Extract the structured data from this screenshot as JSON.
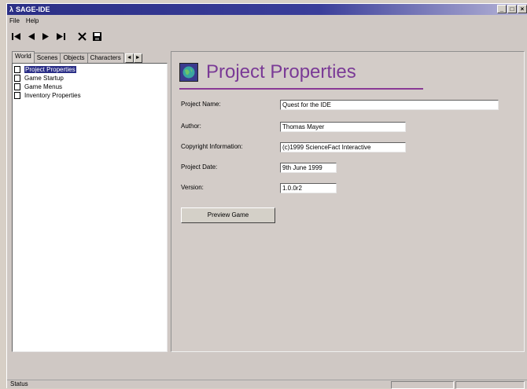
{
  "window": {
    "title": "SAGE-IDE",
    "min": "_",
    "max": "□",
    "close": "×"
  },
  "menu": {
    "file": "File",
    "help": "Help"
  },
  "toolbar": {
    "icons": [
      "first-icon",
      "previous-icon",
      "next-icon",
      "last-icon",
      "delete-icon",
      "save-icon"
    ]
  },
  "tabs": {
    "world": "World",
    "scenes": "Scenes",
    "objects": "Objects",
    "characters": "Characters",
    "left_arrow": "◄",
    "right_arrow": "►"
  },
  "tree": [
    {
      "label": "Project Properties",
      "selected": true
    },
    {
      "label": "Game Startup",
      "selected": false
    },
    {
      "label": "Game Menus",
      "selected": false
    },
    {
      "label": "Inventory Properties",
      "selected": false
    }
  ],
  "page": {
    "title": "Project Properties",
    "accent": "#7a3a96",
    "fields": [
      {
        "label": "Project Name:",
        "value": "Quest for the IDE"
      },
      {
        "label": "Author:",
        "value": "Thomas Mayer"
      },
      {
        "label": "Copyright  Information:",
        "value": "(c)1999 ScienceFact Interactive"
      },
      {
        "label": "Project Date:",
        "value": "9th June 1999"
      },
      {
        "label": "Version:",
        "value": "1.0.0r2"
      }
    ],
    "preview_button": "Preview Game"
  },
  "status": {
    "text": "Status"
  }
}
